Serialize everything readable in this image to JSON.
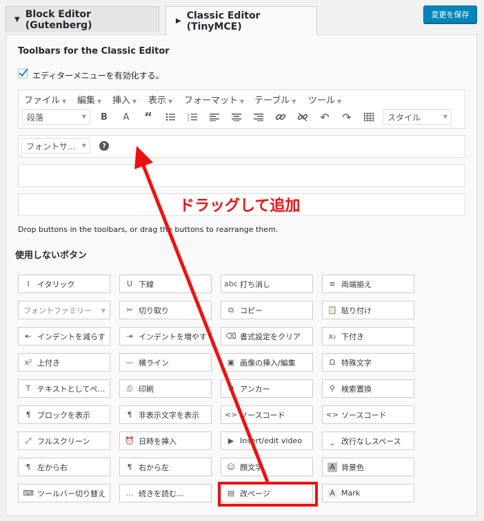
{
  "tabs": [
    {
      "label": "Block Editor (Gutenberg)"
    },
    {
      "label": "Classic Editor (TinyMCE)"
    }
  ],
  "save_button": "変更を保存",
  "section_title": "Toolbars for the Classic Editor",
  "checkbox_label": "エディターメニューを有効化する。",
  "menubar": [
    "ファイル",
    "編集",
    "挿入",
    "表示",
    "フォーマット",
    "テーブル",
    "ツール"
  ],
  "toolbar": {
    "format_select": "段落",
    "style_select": "スタイル",
    "fontsize_select": "フォントサ…",
    "icons": [
      "bold-icon",
      "text-color-icon",
      "blockquote-icon",
      "bullet-list-icon",
      "numbered-list-icon",
      "align-left-icon",
      "align-center-icon",
      "align-right-icon",
      "link-icon",
      "unlink-icon",
      "undo-icon",
      "redo-icon",
      "table-icon"
    ]
  },
  "info_text": "Drop buttons in the toolbars, or drag the buttons to rearrange them.",
  "unused_title": "使用しないボタン",
  "annotation": "ドラッグして追加",
  "buttons": [
    [
      "イタリック",
      "下線",
      "打ち消し",
      "両端揃え"
    ],
    [
      "フォントファミリー",
      "切り取り",
      "コピー",
      "貼り付け"
    ],
    [
      "インデントを減らす",
      "インデントを増やす",
      "書式設定をクリア",
      "下付き"
    ],
    [
      "上付き",
      "横ライン",
      "画像の挿入/編集",
      "特殊文字"
    ],
    [
      "テキストとしてペ…",
      "印刷",
      "アンカー",
      "検索置換"
    ],
    [
      "ブロックを表示",
      "非表示文字を表示",
      "ソースコード",
      "ソースコード"
    ],
    [
      "フルスクリーン",
      "日時を挿入",
      "Insert/edit video",
      "改行なしスペース"
    ],
    [
      "左から右",
      "右から左",
      "顔文字",
      "背景色"
    ],
    [
      "ツールバー切り替え",
      "続きを読む…",
      "改ページ",
      "Mark"
    ]
  ],
  "colors": {
    "accent": "#0085ba",
    "annotation": "#e11111"
  }
}
